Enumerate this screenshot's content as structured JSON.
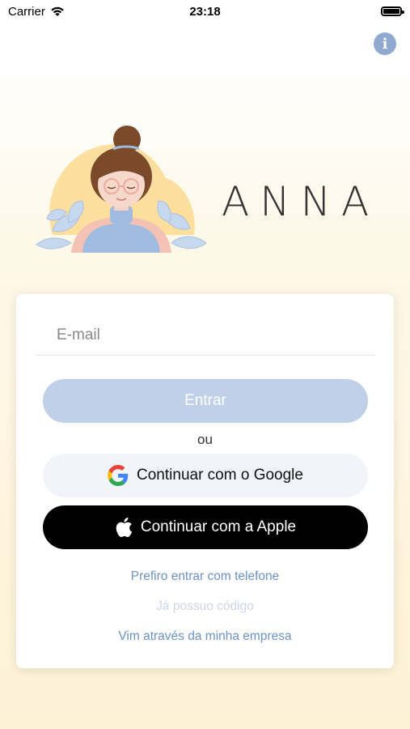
{
  "status_bar": {
    "carrier": "Carrier",
    "time": "23:18"
  },
  "header": {
    "info_icon": "i"
  },
  "brand": {
    "name": "ANNA"
  },
  "login": {
    "email_placeholder": "E-mail",
    "enter_label": "Entrar",
    "or_label": "ou",
    "google_label": "Continuar com o Google",
    "apple_label": "Continuar com a Apple",
    "phone_link": "Prefiro entrar com telefone",
    "code_link": "Já possuo código",
    "company_link": "Vim através da minha empresa"
  },
  "colors": {
    "accent": "#6b92c8",
    "enter_button": "#bfd0e8",
    "info_button": "#8fa9cf",
    "apple_button": "#000000",
    "google_button": "#f1f5fa"
  }
}
